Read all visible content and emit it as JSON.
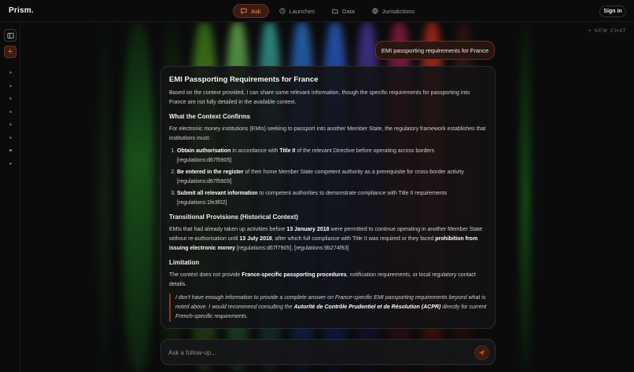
{
  "header": {
    "logo": "Prism.",
    "nav": [
      {
        "label": "Ask",
        "icon": "chat-icon",
        "active": true
      },
      {
        "label": "Launches",
        "icon": "clock-icon",
        "active": false
      },
      {
        "label": "Data",
        "icon": "folder-icon",
        "active": false
      },
      {
        "label": "Jurisdictions",
        "icon": "globe-icon",
        "active": false
      }
    ],
    "signin_label": "Sign in"
  },
  "sidebar": {
    "panel_icon": "sidebar-panel-icon",
    "new_icon": "plus-icon",
    "history_count": 8,
    "active_index": 6
  },
  "new_chat_label": "+ NEW CHAT",
  "user_message": "EMI passporting requirements for France",
  "answer": {
    "title": "EMI Passporting Requirements for France",
    "intro": "Based on the context provided, I can share some relevant information, though the specific requirements for passporting into France are not fully detailed in the available context.",
    "section1_title": "What the Context Confirms",
    "section1_text": "For electronic money institutions (EMIs) seeking to passport into another Member State, the regulatory framework establishes that institutions must:",
    "items": [
      {
        "bold1": "Obtain authorisation",
        "text1": " in accordance with ",
        "bold2": "Title II",
        "text2": " of the relevant Directive before operating across borders [regulations:d67f5905]"
      },
      {
        "bold1": "Be entered in the register",
        "text1": " of their home Member State competent authority as a prerequisite for cross-border activity [regulations:d67f5905]",
        "bold2": "",
        "text2": ""
      },
      {
        "bold1": "Submit all relevant information",
        "text1": " to competent authorities to demonstrate compliance with Title II requirements [regulations:1fe3f02]",
        "bold2": "",
        "text2": ""
      }
    ],
    "section2_title": "Transitional Provisions (Historical Context)",
    "s2_t1": "EMIs that had already taken up activities before ",
    "s2_b1": "13 January 2018",
    "s2_t2": " were permitted to continue operating in another Member State without re-authorisation until ",
    "s2_b2": "13 July 2018",
    "s2_t3": ", after which full compliance with Title II was required or they faced ",
    "s2_b3": "prohibition from issuing electronic money",
    "s2_t4": " [regulations:d67f7905], [regulations:9b274f93]",
    "section3_title": "Limitation",
    "s3_t1": "The context does not provide ",
    "s3_b1": "France-specific passporting procedures",
    "s3_t2": ", notification requirements, or local regulatory contact details.",
    "quote_t1": "I don't have enough information to provide a complete answer on France-specific EMI passporting requirements beyond what is noted above. I would recommend consulting the ",
    "quote_b1": "Autorité de Contrôle Prudentiel et de Résolution (ACPR)",
    "quote_t2": " directly for current French-specific requirements."
  },
  "followup": {
    "placeholder": "Ask a follow-up...",
    "send_icon": "send-icon"
  },
  "colors": {
    "accent": "#ff6a30",
    "background": "#0b0b0c",
    "card": "#121214"
  }
}
